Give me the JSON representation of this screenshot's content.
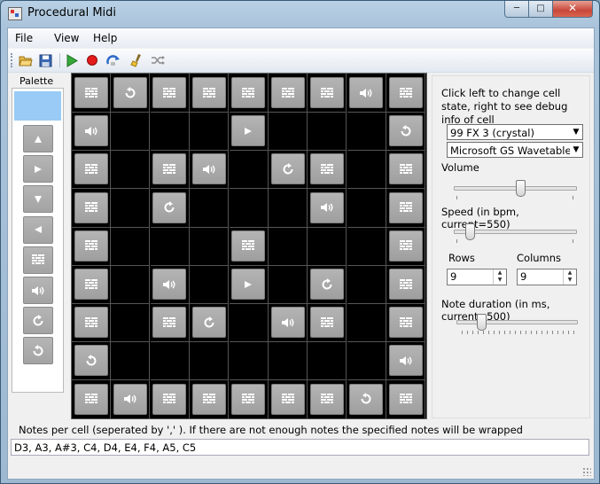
{
  "window": {
    "title": "Procedural Midi"
  },
  "menu": {
    "items": [
      "File",
      "View",
      "Help"
    ]
  },
  "toolbar": {
    "buttons": [
      "open-icon",
      "save-icon",
      "play-icon",
      "record-icon",
      "loop-icon",
      "clear-icon",
      "shuffle-icon"
    ]
  },
  "palette": {
    "label": "Palette",
    "items": [
      "arrow-up-icon",
      "arrow-right-icon",
      "arrow-down-icon",
      "arrow-left-icon",
      "wall-icon",
      "speaker-icon",
      "rotate-cw-icon",
      "rotate-ccw-icon"
    ]
  },
  "grid": {
    "rows": 9,
    "cols": 9,
    "cells": [
      [
        "wall",
        "ccw",
        "wall",
        "wall",
        "wall",
        "wall",
        "wall",
        "speaker",
        "wall"
      ],
      [
        "speaker",
        "",
        "",
        "",
        "right",
        "",
        "",
        "",
        "ccw"
      ],
      [
        "wall",
        "",
        "wall",
        "speaker",
        "",
        "cw",
        "wall",
        "",
        "wall"
      ],
      [
        "wall",
        "",
        "cw",
        "",
        "",
        "",
        "speaker",
        "",
        "wall"
      ],
      [
        "wall",
        "",
        "",
        "",
        "wall",
        "",
        "",
        "",
        "wall"
      ],
      [
        "wall",
        "",
        "speaker",
        "",
        "right",
        "",
        "cw",
        "",
        "wall"
      ],
      [
        "wall",
        "",
        "wall",
        "cw",
        "",
        "speaker",
        "wall",
        "",
        "wall"
      ],
      [
        "ccw",
        "",
        "",
        "",
        "",
        "",
        "",
        "",
        "speaker"
      ],
      [
        "wall",
        "speaker",
        "wall",
        "wall",
        "wall",
        "wall",
        "wall",
        "ccw",
        "wall"
      ]
    ]
  },
  "settings": {
    "info": "Click left to change cell state, right to see debug info of cell",
    "instrument": "99 FX 3 (crystal)",
    "device": "Microsoft GS Wavetable Sy",
    "volume_label": "Volume",
    "volume_level": 0.55,
    "speed_label": "Speed (in bpm, current=550)",
    "speed_level": 0.1,
    "rows_label": "Rows",
    "rows_value": "9",
    "columns_label": "Columns",
    "columns_value": "9",
    "duration_label": "Note duration (in ms, current=500)",
    "duration_level": 0.18
  },
  "notes": {
    "label": "Notes per cell (seperated by ',' ). If there are not enough notes the specified notes will be wrapped",
    "value": "D3, A3, A#3, C4, D4, E4, F4, A5, C5"
  },
  "colors": {
    "palette_selected": "#99cbf6",
    "tile": "#a9a9a9",
    "grid_bg": "#000000"
  }
}
